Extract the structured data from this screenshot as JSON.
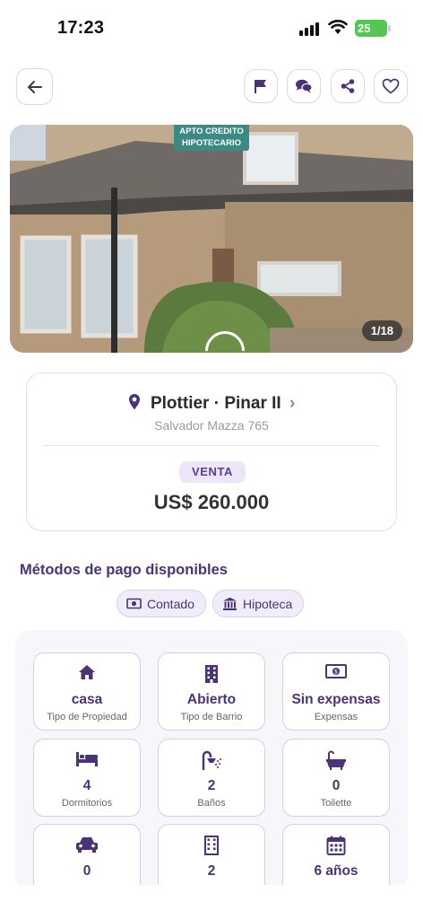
{
  "status_bar": {
    "time": "17:23",
    "battery": "25"
  },
  "photo": {
    "badge_line1": "APTO CREDITO",
    "badge_line2": "HIPOTECARIO",
    "counter": "1/18"
  },
  "location": {
    "title": "Plottier · Pinar II",
    "address": "Salvador Mazza 765",
    "operation": "VENTA",
    "price": "US$ 260.000"
  },
  "payment": {
    "title": "Métodos de pago disponibles",
    "methods": [
      {
        "label": "Contado",
        "icon": "cash-icon"
      },
      {
        "label": "Hipoteca",
        "icon": "bank-icon"
      }
    ]
  },
  "features": [
    {
      "value": "casa",
      "label": "Tipo de Propiedad",
      "icon": "house-icon"
    },
    {
      "value": "Abierto",
      "label": "Tipo de Barrio",
      "icon": "building-icon"
    },
    {
      "value": "Sin expensas",
      "label": "Expensas",
      "icon": "cash-icon"
    },
    {
      "value": "4",
      "label": "Dormitorios",
      "icon": "bed-icon"
    },
    {
      "value": "2",
      "label": "Baños",
      "icon": "shower-icon"
    },
    {
      "value": "0",
      "label": "Toilette",
      "icon": "bathtub-icon"
    },
    {
      "value": "0",
      "label": "",
      "icon": "car-icon"
    },
    {
      "value": "2",
      "label": "",
      "icon": "building-icon"
    },
    {
      "value": "6 años",
      "label": "",
      "icon": "calendar-icon"
    }
  ],
  "colors": {
    "accent": "#4a3377",
    "chip_bg": "#f1ecfa",
    "border": "#d6cfe4"
  }
}
